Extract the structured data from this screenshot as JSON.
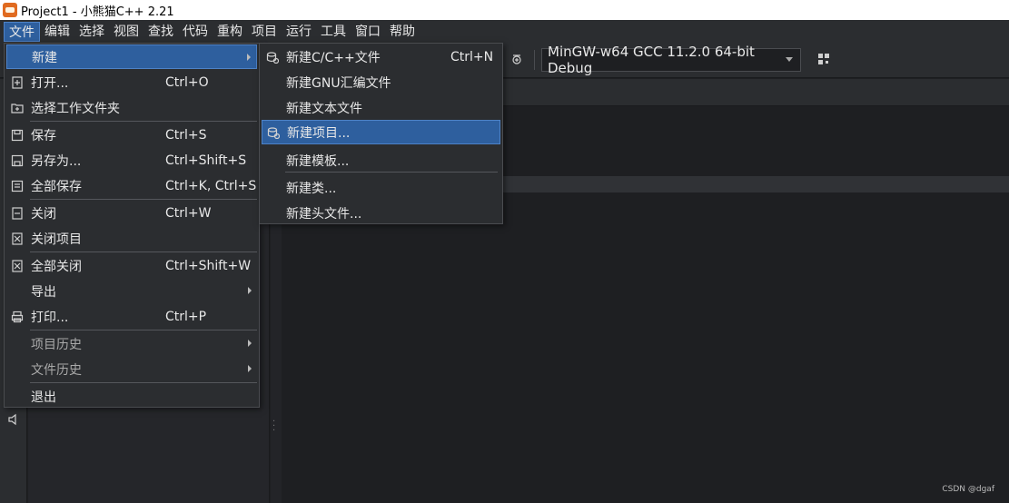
{
  "window": {
    "title": "Project1 - 小熊猫C++ 2.21"
  },
  "menubar": {
    "items": [
      "文件",
      "编辑",
      "选择",
      "视图",
      "查找",
      "代码",
      "重构",
      "项目",
      "运行",
      "工具",
      "窗口",
      "帮助"
    ]
  },
  "toolbar": {
    "compiler": "MinGW-w64 GCC 11.2.0 64-bit Debug"
  },
  "file_menu": {
    "items": [
      {
        "label": "新建",
        "shortcut": "",
        "icon": "none",
        "submenu": true,
        "highlighted": true
      },
      {
        "label": "打开...",
        "shortcut": "Ctrl+O",
        "icon": "open-file-icon"
      },
      {
        "label": "选择工作文件夹",
        "shortcut": "",
        "icon": "folder-icon"
      },
      {
        "label": "保存",
        "shortcut": "Ctrl+S",
        "icon": "save-icon"
      },
      {
        "label": "另存为...",
        "shortcut": "Ctrl+Shift+S",
        "icon": "save-as-icon"
      },
      {
        "label": "全部保存",
        "shortcut": "Ctrl+K, Ctrl+S",
        "icon": "save-all-icon"
      },
      {
        "label": "关闭",
        "shortcut": "Ctrl+W",
        "icon": "close-file-icon"
      },
      {
        "label": "关闭项目",
        "shortcut": "",
        "icon": "close-project-icon"
      },
      {
        "label": "全部关闭",
        "shortcut": "Ctrl+Shift+W",
        "icon": "close-all-icon"
      },
      {
        "label": "导出",
        "shortcut": "",
        "icon": "none",
        "submenu": true
      },
      {
        "label": "打印...",
        "shortcut": "Ctrl+P",
        "icon": "print-icon"
      },
      {
        "label": "项目历史",
        "shortcut": "",
        "icon": "none",
        "submenu": true,
        "disabled": true
      },
      {
        "label": "文件历史",
        "shortcut": "",
        "icon": "none",
        "submenu": true,
        "disabled": true
      },
      {
        "label": "退出",
        "shortcut": "",
        "icon": "none"
      }
    ]
  },
  "new_menu": {
    "items": [
      {
        "label": "新建C/C++文件",
        "shortcut": "Ctrl+N",
        "icon": "new-file-icon"
      },
      {
        "label": "新建GNU汇编文件",
        "shortcut": ""
      },
      {
        "label": "新建文本文件",
        "shortcut": ""
      },
      {
        "label": "新建项目...",
        "shortcut": "",
        "icon": "new-project-icon",
        "highlighted": true
      },
      {
        "label": "新建模板...",
        "shortcut": ""
      },
      {
        "label": "新建类...",
        "shortcut": ""
      },
      {
        "label": "新建头文件...",
        "shortcut": ""
      }
    ]
  },
  "watermark": "CSDN @dgaf",
  "colors": {
    "accent": "#2e5f9e",
    "background": "#1e1f22",
    "panel": "#2b2d30"
  }
}
